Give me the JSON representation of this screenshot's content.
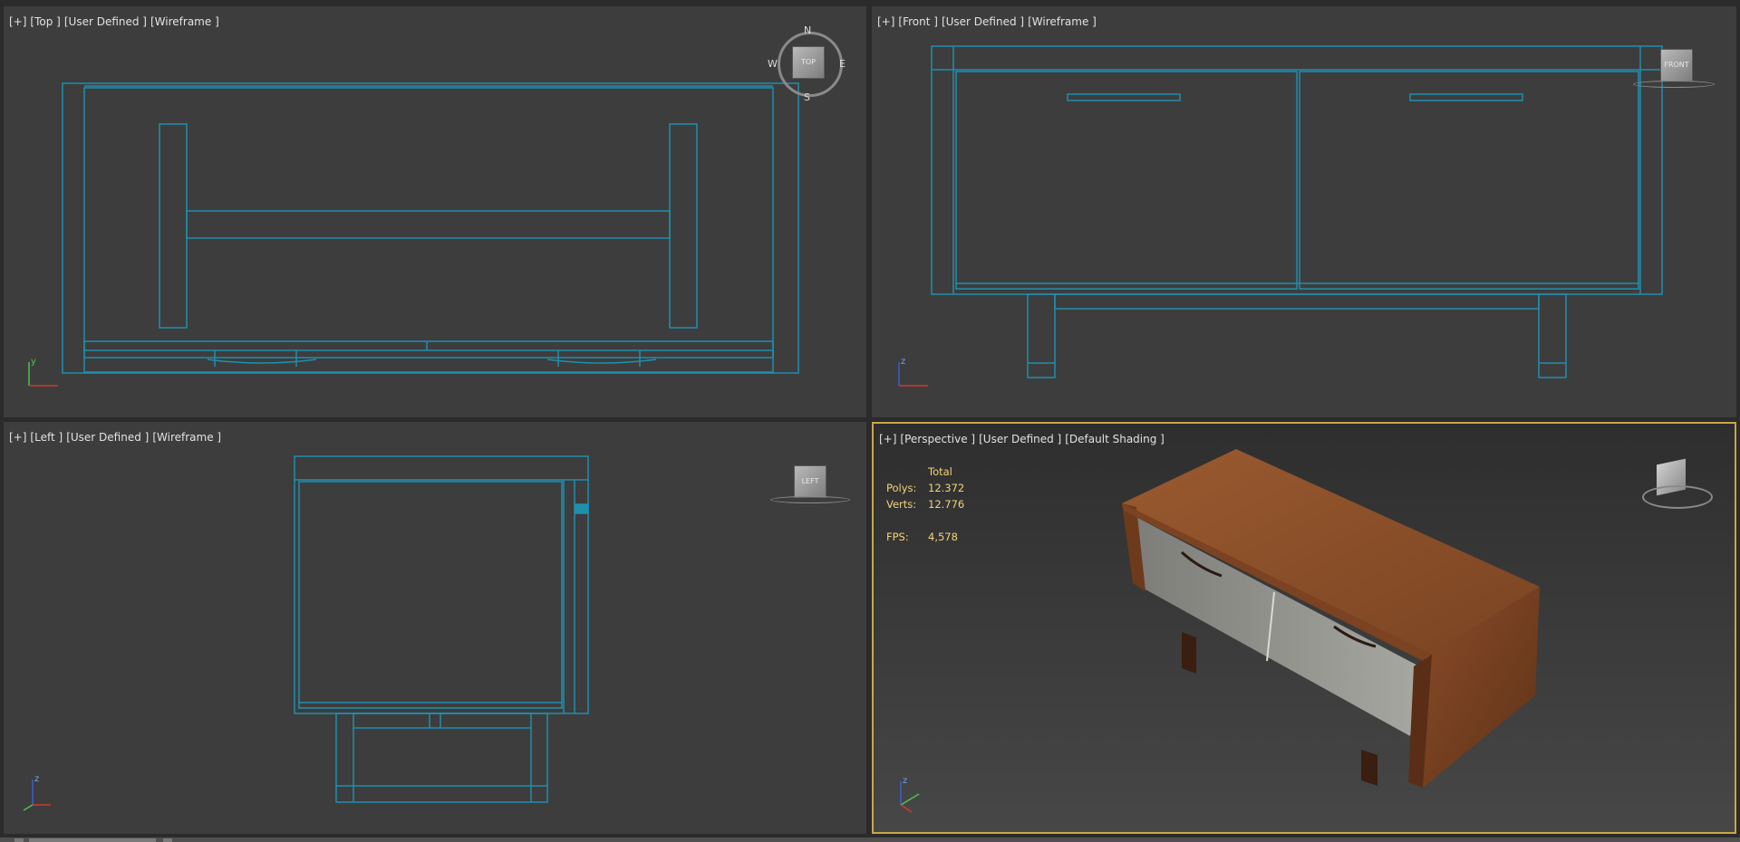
{
  "viewports": {
    "top": {
      "plus": "[+]",
      "view": "[Top ]",
      "mode": "[User Defined ]",
      "shading": "[Wireframe ]"
    },
    "front": {
      "plus": "[+]",
      "view": "[Front ]",
      "mode": "[User Defined ]",
      "shading": "[Wireframe ]"
    },
    "left": {
      "plus": "[+]",
      "view": "[Left ]",
      "mode": "[User Defined ]",
      "shading": "[Wireframe ]"
    },
    "persp": {
      "plus": "[+]",
      "view": "[Perspective ]",
      "mode": "[User Defined ]",
      "shading": "[Default Shading ]"
    }
  },
  "compass": {
    "n": "N",
    "s": "S",
    "e": "E",
    "w": "W",
    "cube": "TOP"
  },
  "view_cubes": {
    "front": "FRONT",
    "left": "LEFT"
  },
  "axes": {
    "x": "x",
    "y": "y",
    "z": "z"
  },
  "stats": {
    "header": "Total",
    "polys_label": "Polys:",
    "polys": "12.372",
    "verts_label": "Verts:",
    "verts": "12.776",
    "fps_label": "FPS:",
    "fps": "4,578"
  },
  "colors": {
    "wire": "#1f8fae",
    "active_border": "#c9a64a",
    "stat_text": "#f2d27a",
    "wood": "#8a4f2a",
    "door": "#9c9c96"
  }
}
